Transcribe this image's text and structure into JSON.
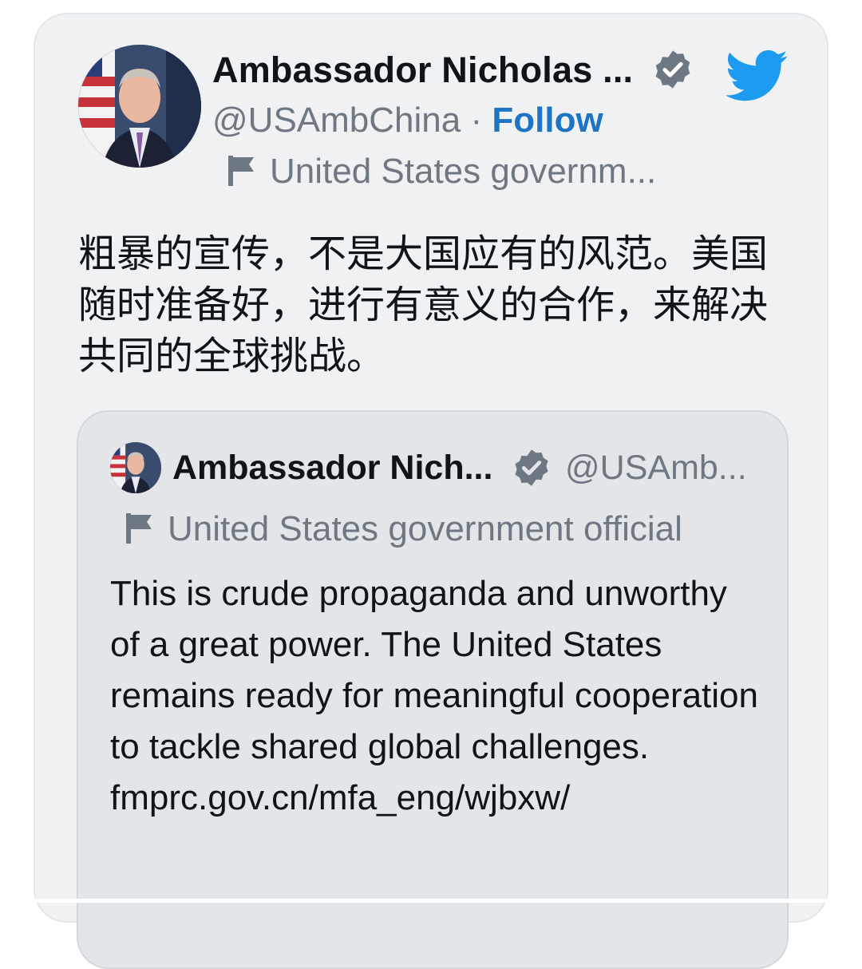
{
  "tweet": {
    "author_name": "Ambassador Nicholas ...",
    "handle": "@USAmbChina",
    "separator": "·",
    "follow_label": "Follow",
    "affiliation": "United States governm...",
    "text": "粗暴的宣传，不是大国应有的风范。美国随时准备好，进行有意义的合作，来解决共同的全球挑战。",
    "icons": {
      "verified": "verified-badge-icon",
      "brand": "twitter-bird-icon",
      "flag": "flag-icon"
    },
    "colors": {
      "follow": "#1d74c4",
      "brand": "#1d9bf0",
      "verified": "#6e7883"
    }
  },
  "quoted_tweet": {
    "author_name": "Ambassador Nich...",
    "handle": "@USAmb...",
    "affiliation": "United States government official",
    "text": "This is crude propaganda and unworthy of a great power. The United States remains ready for meaningful cooperation to tackle shared global challenges.",
    "link": "fmprc.gov.cn/mfa_eng/wjbxw/"
  }
}
